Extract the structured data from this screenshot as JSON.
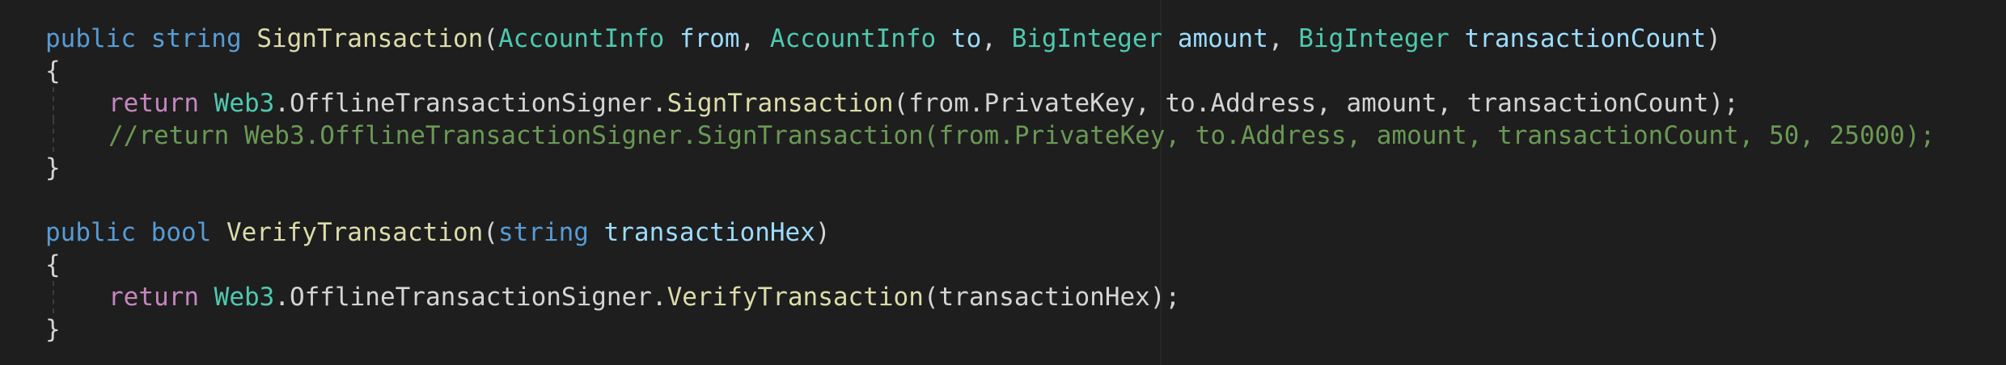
{
  "editor": {
    "colors": {
      "background": "#1e1e1e",
      "keyword": "#569cd6",
      "control_keyword": "#c586c0",
      "function": "#dcdcaa",
      "type": "#4ec9b0",
      "parameter": "#9cdcfe",
      "text": "#d4d4d4",
      "comment": "#6a9955"
    },
    "lines": [
      {
        "tokens": [
          {
            "text": "public",
            "class": "kw"
          },
          {
            "text": " ",
            "class": "punc"
          },
          {
            "text": "string",
            "class": "kw"
          },
          {
            "text": " ",
            "class": "punc"
          },
          {
            "text": "SignTransaction",
            "class": "fn"
          },
          {
            "text": "(",
            "class": "punc"
          },
          {
            "text": "AccountInfo",
            "class": "type"
          },
          {
            "text": " ",
            "class": "punc"
          },
          {
            "text": "from",
            "class": "param"
          },
          {
            "text": ", ",
            "class": "punc"
          },
          {
            "text": "AccountInfo",
            "class": "type"
          },
          {
            "text": " ",
            "class": "punc"
          },
          {
            "text": "to",
            "class": "param"
          },
          {
            "text": ", ",
            "class": "punc"
          },
          {
            "text": "BigInteger",
            "class": "type"
          },
          {
            "text": " ",
            "class": "punc"
          },
          {
            "text": "amount",
            "class": "param"
          },
          {
            "text": ", ",
            "class": "punc"
          },
          {
            "text": "BigInteger",
            "class": "type"
          },
          {
            "text": " ",
            "class": "punc"
          },
          {
            "text": "transactionCount",
            "class": "param"
          },
          {
            "text": ")",
            "class": "punc"
          }
        ]
      },
      {
        "tokens": [
          {
            "text": "{",
            "class": "punc"
          }
        ]
      },
      {
        "guide": true,
        "indent": true,
        "tokens": [
          {
            "text": "return",
            "class": "ctrl"
          },
          {
            "text": " ",
            "class": "punc"
          },
          {
            "text": "Web3",
            "class": "type"
          },
          {
            "text": ".OfflineTransactionSigner.",
            "class": "punc"
          },
          {
            "text": "SignTransaction",
            "class": "fn"
          },
          {
            "text": "(from.PrivateKey, to.Address, amount, transactionCount);",
            "class": "punc"
          }
        ]
      },
      {
        "guide": true,
        "indent": true,
        "tokens": [
          {
            "text": "//return Web3.OfflineTransactionSigner.SignTransaction(from.PrivateKey, to.Address, amount, transactionCount, 50, 25000);",
            "class": "cmt"
          }
        ]
      },
      {
        "tokens": [
          {
            "text": "}",
            "class": "punc"
          }
        ]
      },
      {
        "tokens": []
      },
      {
        "tokens": [
          {
            "text": "public",
            "class": "kw"
          },
          {
            "text": " ",
            "class": "punc"
          },
          {
            "text": "bool",
            "class": "kw"
          },
          {
            "text": " ",
            "class": "punc"
          },
          {
            "text": "VerifyTransaction",
            "class": "fn"
          },
          {
            "text": "(",
            "class": "punc"
          },
          {
            "text": "string",
            "class": "kw"
          },
          {
            "text": " ",
            "class": "punc"
          },
          {
            "text": "transactionHex",
            "class": "param"
          },
          {
            "text": ")",
            "class": "punc"
          }
        ]
      },
      {
        "tokens": [
          {
            "text": "{",
            "class": "punc"
          }
        ]
      },
      {
        "guide": true,
        "indent": true,
        "tokens": [
          {
            "text": "return",
            "class": "ctrl"
          },
          {
            "text": " ",
            "class": "punc"
          },
          {
            "text": "Web3",
            "class": "type"
          },
          {
            "text": ".OfflineTransactionSigner.",
            "class": "punc"
          },
          {
            "text": "VerifyTransaction",
            "class": "fn"
          },
          {
            "text": "(transactionHex);",
            "class": "punc"
          }
        ]
      },
      {
        "tokens": [
          {
            "text": "}",
            "class": "punc"
          }
        ]
      }
    ]
  }
}
